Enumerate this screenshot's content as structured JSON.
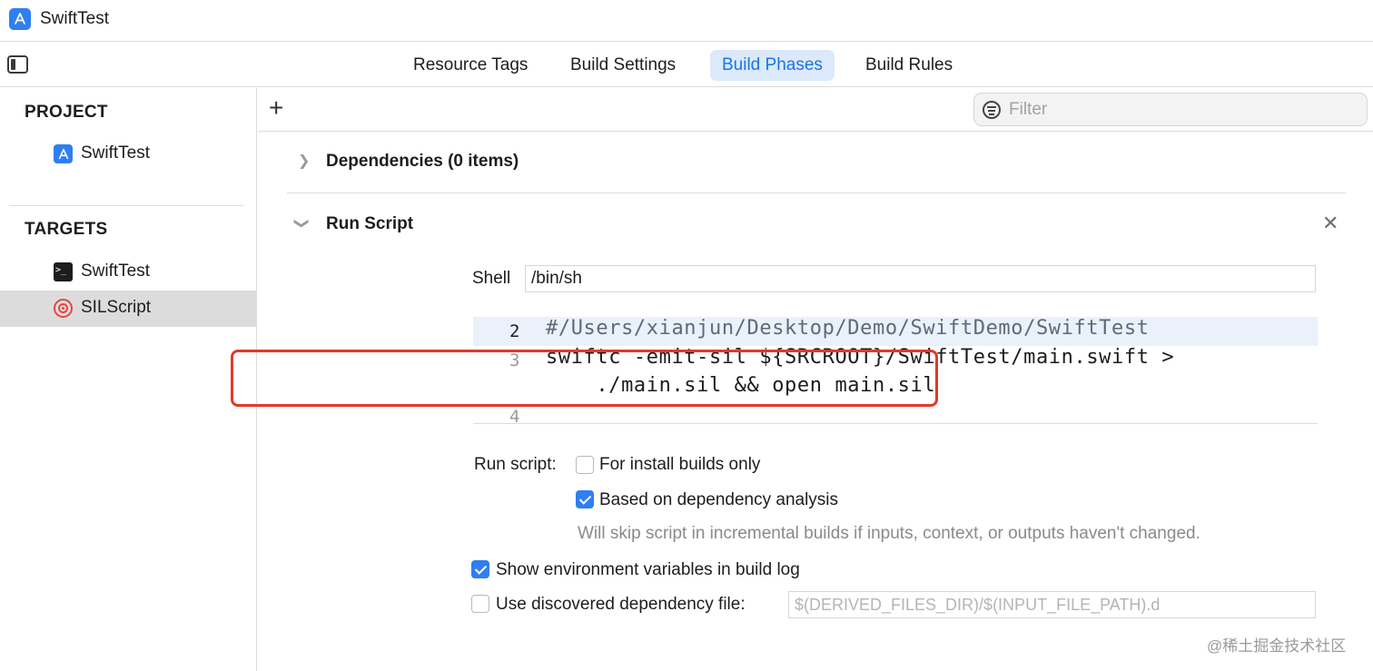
{
  "window": {
    "title": "SwiftTest"
  },
  "tabs": [
    {
      "label": "Resource Tags",
      "active": false
    },
    {
      "label": "Build Settings",
      "active": false
    },
    {
      "label": "Build Phases",
      "active": true
    },
    {
      "label": "Build Rules",
      "active": false
    }
  ],
  "sidebar": {
    "project_heading": "PROJECT",
    "project_items": [
      {
        "label": "SwiftTest",
        "icon": "app-icon"
      }
    ],
    "targets_heading": "TARGETS",
    "target_items": [
      {
        "label": "SwiftTest",
        "icon": "terminal-icon",
        "selected": false
      },
      {
        "label": "SILScript",
        "icon": "target-icon",
        "selected": true
      }
    ]
  },
  "toolbar": {
    "add_label": "+",
    "filter_placeholder": "Filter"
  },
  "phases": {
    "dependencies": {
      "title": "Dependencies (0 items)",
      "expanded": false
    },
    "run_script": {
      "title": "Run Script",
      "expanded": true,
      "shell_label": "Shell",
      "shell_value": "/bin/sh",
      "code_lines": [
        {
          "number": "2",
          "text": "#/Users/xianjun/Desktop/Demo/SwiftDemo/SwiftTest"
        },
        {
          "number": "3",
          "text": "swiftc -emit-sil ${SRCROOT}/SwiftTest/main.swift >"
        },
        {
          "number": "",
          "text": "    ./main.sil && open main.sil"
        },
        {
          "number": "4",
          "text": ""
        }
      ],
      "run_script_label": "Run script:",
      "install_builds_label": "For install builds only",
      "install_builds_checked": false,
      "dependency_analysis_label": "Based on dependency analysis",
      "dependency_analysis_checked": true,
      "dependency_hint": "Will skip script in incremental builds if inputs, context, or outputs haven't changed.",
      "env_vars_label": "Show environment variables in build log",
      "env_vars_checked": true,
      "dep_file_label": "Use discovered dependency file:",
      "dep_file_checked": false,
      "dep_file_placeholder": "$(DERIVED_FILES_DIR)/$(INPUT_FILE_PATH).d"
    }
  },
  "colors": {
    "accent": "#2f7ff0",
    "annotation_red": "#e0392b"
  },
  "watermark": "@稀土掘金技术社区"
}
